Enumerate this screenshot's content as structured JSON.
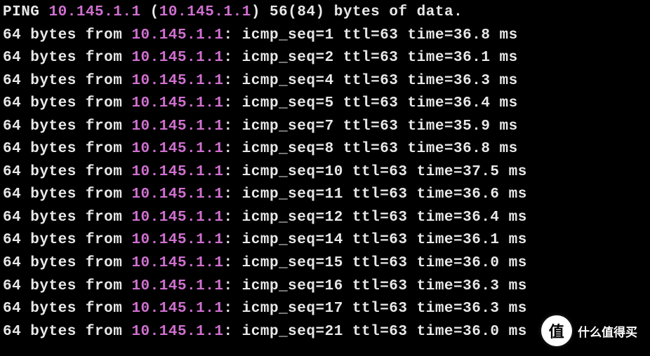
{
  "header": {
    "cmd": "PING",
    "target_ip": "10.145.1.1",
    "paren_open": "(",
    "paren_ip": "10.145.1.1",
    "paren_close": ")",
    "size_text": "56(84) bytes of data."
  },
  "reply_template": {
    "prefix": "64 bytes from ",
    "colon_sp": ": ",
    "icmp_label": "icmp_seq=",
    "ttl_label": " ttl=",
    "time_label": " time=",
    "ms": " ms"
  },
  "replies": [
    {
      "ip": "10.145.1.1",
      "seq": "1",
      "ttl": "63",
      "time": "36.8"
    },
    {
      "ip": "10.145.1.1",
      "seq": "2",
      "ttl": "63",
      "time": "36.1"
    },
    {
      "ip": "10.145.1.1",
      "seq": "4",
      "ttl": "63",
      "time": "36.3"
    },
    {
      "ip": "10.145.1.1",
      "seq": "5",
      "ttl": "63",
      "time": "36.4"
    },
    {
      "ip": "10.145.1.1",
      "seq": "7",
      "ttl": "63",
      "time": "35.9"
    },
    {
      "ip": "10.145.1.1",
      "seq": "8",
      "ttl": "63",
      "time": "36.8"
    },
    {
      "ip": "10.145.1.1",
      "seq": "10",
      "ttl": "63",
      "time": "37.5"
    },
    {
      "ip": "10.145.1.1",
      "seq": "11",
      "ttl": "63",
      "time": "36.6"
    },
    {
      "ip": "10.145.1.1",
      "seq": "12",
      "ttl": "63",
      "time": "36.4"
    },
    {
      "ip": "10.145.1.1",
      "seq": "14",
      "ttl": "63",
      "time": "36.1"
    },
    {
      "ip": "10.145.1.1",
      "seq": "15",
      "ttl": "63",
      "time": "36.0"
    },
    {
      "ip": "10.145.1.1",
      "seq": "16",
      "ttl": "63",
      "time": "36.3"
    },
    {
      "ip": "10.145.1.1",
      "seq": "17",
      "ttl": "63",
      "time": "36.3"
    },
    {
      "ip": "10.145.1.1",
      "seq": "21",
      "ttl": "63",
      "time": "36.0"
    }
  ],
  "badge": {
    "circle": "值",
    "text": "什么值得买"
  }
}
